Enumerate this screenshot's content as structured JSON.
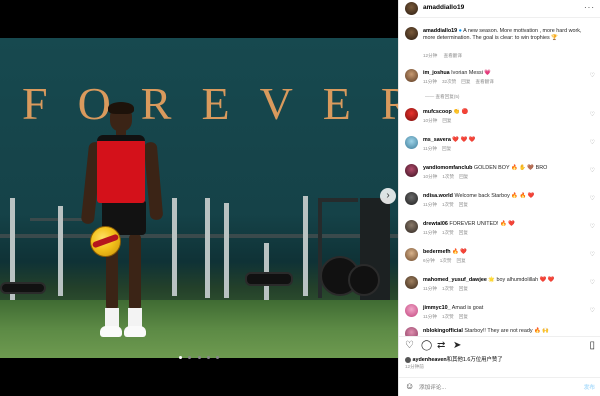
{
  "media": {
    "wall_text": "FOREVER",
    "next_icon": "chevron-right-icon",
    "carousel_dots": 5,
    "active_dot": 1
  },
  "header": {
    "username": "amaddiallo19",
    "more_label": "···"
  },
  "caption": {
    "username": "amaddiallo19",
    "text": "A new season. More motivation , more hard work, more determination. The goal is clear: to win trophies 🏆",
    "time": "12分钟",
    "translate": "查看翻译"
  },
  "comments": [
    {
      "username": "im_joshua",
      "text": "Ivorian Messi 💗",
      "time": "11分钟",
      "likes": "32次赞",
      "reply": "回复",
      "translate": "查看翻译",
      "replies": "查看回复(5)"
    },
    {
      "username": "mufcscoop",
      "text": "👏 🔴",
      "time": "10分钟",
      "likes": "",
      "reply": "回复",
      "translate": "",
      "replies": ""
    },
    {
      "username": "ms_savera",
      "text": "❤️ ❤️ ❤️",
      "time": "11分钟",
      "likes": "",
      "reply": "回复",
      "translate": "",
      "replies": ""
    },
    {
      "username": "yandiomomfanclub",
      "text": "GOLDEN BOY 🔥 ✋ 🤎 BRO",
      "time": "10分钟",
      "likes": "1次赞",
      "reply": "回复",
      "translate": "",
      "replies": ""
    },
    {
      "username": "ndisa.world",
      "text": "Welcome back Starboy 🔥 🔥 ❤️",
      "time": "11分钟",
      "likes": "1次赞",
      "reply": "回复",
      "translate": "",
      "replies": ""
    },
    {
      "username": "drewtal06",
      "text": "FOREVER UNITED! 🔥 ❤️",
      "time": "11分钟",
      "likes": "1次赞",
      "reply": "回复",
      "translate": "",
      "replies": ""
    },
    {
      "username": "bedermefh",
      "text": "🔥 ❤️",
      "time": "6分钟",
      "likes": "1次赞",
      "reply": "回复",
      "translate": "",
      "replies": ""
    },
    {
      "username": "mahomed_yusuf_dawjee",
      "text": "🌟 boy alhumdolillah ❤️ ❤️",
      "time": "11分钟",
      "likes": "1次赞",
      "reply": "回复",
      "translate": "",
      "replies": ""
    },
    {
      "username": "jimmyc10_",
      "text": "Amad is goat",
      "time": "11分钟",
      "likes": "1次赞",
      "reply": "回复",
      "translate": "",
      "replies": ""
    },
    {
      "username": "nblokingofficial",
      "text": "Starboy!! They are not ready 🔥 🙌",
      "time": "",
      "likes": "",
      "reply": "",
      "translate": "",
      "replies": ""
    }
  ],
  "actions": {
    "like_icon": "heart-icon",
    "comment_icon": "comment-icon",
    "share_icon": "repost-icon",
    "send_icon": "send-icon",
    "save_icon": "bookmark-icon"
  },
  "likes_line": {
    "username": "aydenheaven",
    "text": "和其他1.6万位用户赞了"
  },
  "post_time": "12分钟前",
  "composer": {
    "placeholder": "添加评论...",
    "post_label": "发布"
  },
  "colors": {
    "link": "#0095f6",
    "heart": "#ed4956",
    "wall_text": "#d99a5d"
  }
}
